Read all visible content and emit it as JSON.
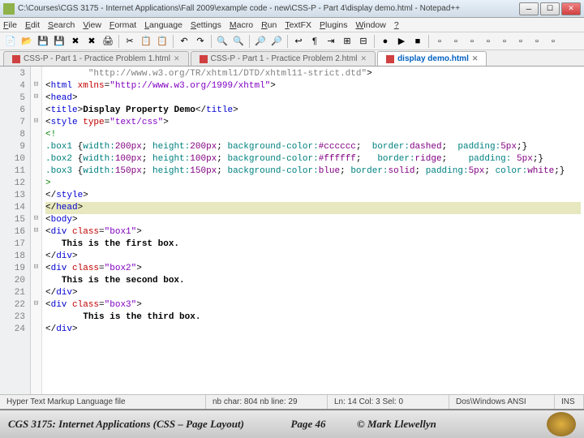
{
  "title": "C:\\Courses\\CGS 3175 - Internet Applications\\Fall 2009\\example code - new\\CSS-P - Part 4\\display demo.html - Notepad++",
  "menu": [
    "File",
    "Edit",
    "Search",
    "View",
    "Format",
    "Language",
    "Settings",
    "Macro",
    "Run",
    "TextFX",
    "Plugins",
    "Window",
    "?"
  ],
  "tabs": [
    {
      "label": "CSS-P - Part 1 - Practice Problem 1.html",
      "active": false
    },
    {
      "label": "CSS-P - Part 1 - Practice Problem 2.html",
      "active": false
    },
    {
      "label": "display demo.html",
      "active": true
    }
  ],
  "gutter_start": 3,
  "gutter_end": 24,
  "code_lines": [
    {
      "html": "        <span class='t-str'>\"http://www.w3.org/TR/xhtml1/DTD/xhtml11-strict.dtd\"</span>&gt;"
    },
    {
      "html": "&lt;<span class='t-tag'>html</span> <span class='t-attr'>xmlns</span>=<span class='t-aval'>\"http://www.w3.org/1999/xhtml\"</span>&gt;",
      "fold": "⊟"
    },
    {
      "html": "&lt;<span class='t-tag'>head</span>&gt;",
      "fold": "⊟"
    },
    {
      "html": "&lt;<span class='t-tag'>title</span>&gt;<span class='t-text'>Display Property Demo</span>&lt;/<span class='t-tag'>title</span>&gt;"
    },
    {
      "html": "&lt;<span class='t-tag'>style</span> <span class='t-attr'>type</span>=<span class='t-aval'>\"text/css\"</span>&gt;",
      "fold": "⊟"
    },
    {
      "html": "<span class='t-comm'>&lt;!</span>"
    },
    {
      "html": "<span class='t-css'>.box1</span> {<span class='t-css'>width:</span><span class='t-cssv'>200px</span>; <span class='t-css'>height:</span><span class='t-cssv'>200px</span>; <span class='t-css'>background-color:</span><span class='t-cssv'>#cccccc</span>;  <span class='t-css'>border:</span><span class='t-cssv'>dashed</span>;  <span class='t-css'>padding:</span><span class='t-cssv'>5px</span>;}"
    },
    {
      "html": "<span class='t-css'>.box2</span> {<span class='t-css'>width:</span><span class='t-cssv'>100px</span>; <span class='t-css'>height:</span><span class='t-cssv'>100px</span>; <span class='t-css'>background-color:</span><span class='t-cssv'>#ffffff</span>;   <span class='t-css'>border:</span><span class='t-cssv'>ridge</span>;    <span class='t-css'>padding:</span> <span class='t-cssv'>5px</span>;}"
    },
    {
      "html": "<span class='t-css'>.box3</span> {<span class='t-css'>width:</span><span class='t-cssv'>150px</span>; <span class='t-css'>height:</span><span class='t-cssv'>150px</span>; <span class='t-css'>background-color:</span><span class='t-cssv'>blue</span>; <span class='t-css'>border:</span><span class='t-cssv'>solid</span>; <span class='t-css'>padding:</span><span class='t-cssv'>5px</span>; <span class='t-css'>color:</span><span class='t-cssv'>white</span>;}"
    },
    {
      "html": "<span class='t-comm'>&gt;</span>"
    },
    {
      "html": "&lt;/<span class='t-tag'>style</span>&gt;"
    },
    {
      "html": "&lt;/<span class='t-tag'>head</span>&gt;",
      "current": true
    },
    {
      "html": "&lt;<span class='t-tag'>body</span>&gt;",
      "fold": "⊟"
    },
    {
      "html": "&lt;<span class='t-tag'>div</span> <span class='t-attr'>class</span>=<span class='t-aval'>\"box1\"</span>&gt;",
      "fold": "⊟"
    },
    {
      "html": "   <span class='t-text'>This is the first box.</span>"
    },
    {
      "html": "&lt;/<span class='t-tag'>div</span>&gt;"
    },
    {
      "html": "&lt;<span class='t-tag'>div</span> <span class='t-attr'>class</span>=<span class='t-aval'>\"box2\"</span>&gt;",
      "fold": "⊟"
    },
    {
      "html": "   <span class='t-text'>This is the second box.</span>"
    },
    {
      "html": "&lt;/<span class='t-tag'>div</span>&gt;"
    },
    {
      "html": "&lt;<span class='t-tag'>div</span> <span class='t-attr'>class</span>=<span class='t-aval'>\"box3\"</span>&gt;",
      "fold": "⊟"
    },
    {
      "html": "       <span class='t-text'>This is the third box.</span>"
    },
    {
      "html": "&lt;/<span class='t-tag'>div</span>&gt;"
    }
  ],
  "status": {
    "type": "Hyper Text Markup Language file",
    "chars": "nb char: 804    nb line: 29",
    "pos": "Ln: 14    Col: 3    Sel: 0",
    "enc": "Dos\\Windows   ANSI",
    "ins": "INS"
  },
  "footer": {
    "course": "CGS 3175: Internet Applications (CSS – Page Layout)",
    "page": "Page 46",
    "author": "© Mark Llewellyn"
  },
  "toolbar_icons": [
    "new",
    "open",
    "save",
    "save-all",
    "close",
    "close-all",
    "print",
    "|",
    "cut",
    "copy",
    "paste",
    "|",
    "undo",
    "redo",
    "|",
    "find",
    "replace",
    "|",
    "zoom-in",
    "zoom-out",
    "|",
    "wrap",
    "chars",
    "indent",
    "fold",
    "unfold",
    "|",
    "rec",
    "play",
    "stop",
    "|",
    "p1",
    "p2",
    "p3",
    "p4",
    "p5",
    "p6",
    "p7",
    "p8"
  ]
}
